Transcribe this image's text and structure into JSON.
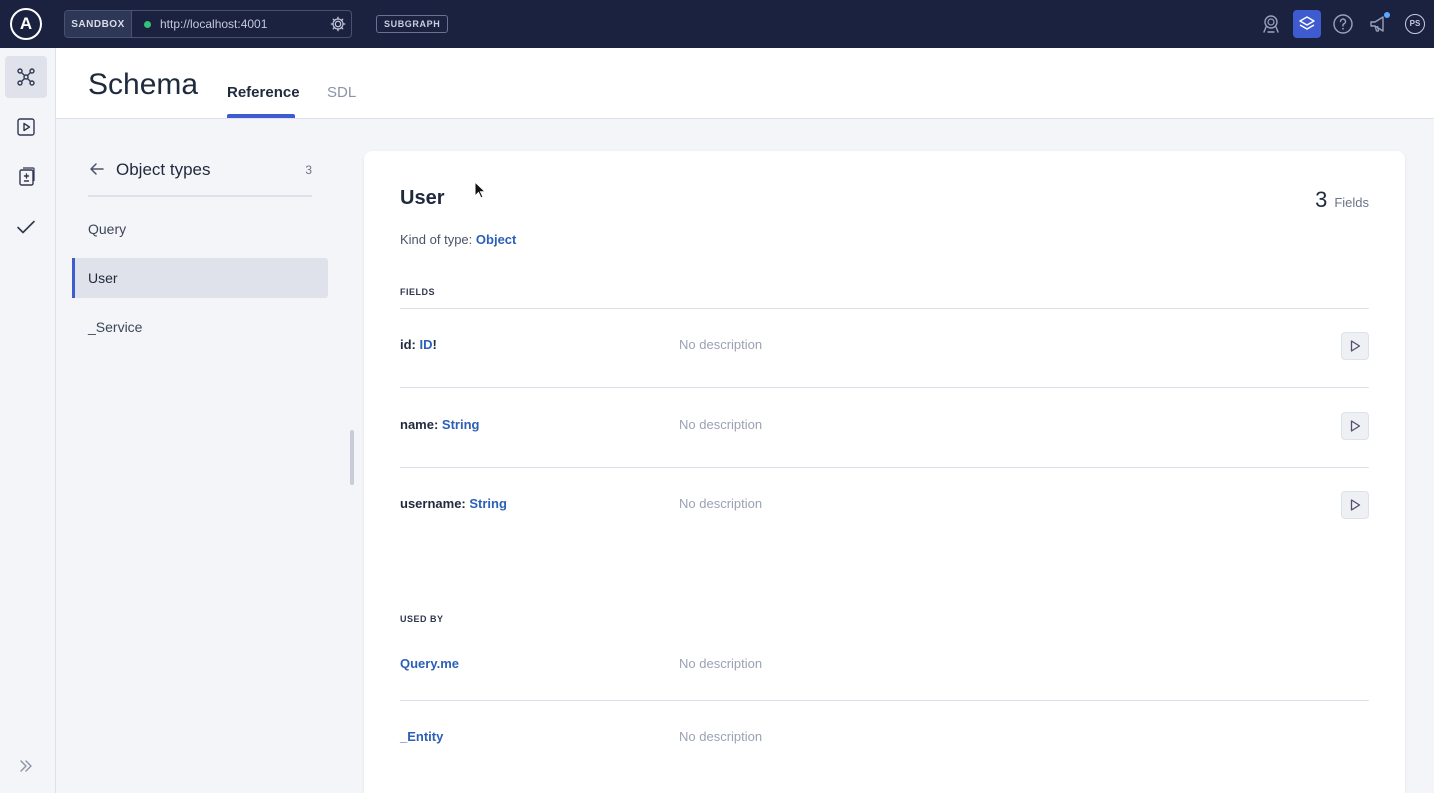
{
  "topbar": {
    "logo": "A",
    "sandbox_label": "SANDBOX",
    "url": "http://localhost:4001",
    "subgraph_label": "SUBGRAPH",
    "avatar_initials": "PS",
    "accent_color": "#3f5bd0",
    "status_color": "#36c07a"
  },
  "rail": {
    "items": [
      "schema-icon",
      "play-icon",
      "document-diff-icon",
      "check-icon"
    ],
    "expand_icon": "double-chevron-right-icon"
  },
  "header": {
    "title": "Schema",
    "tabs": [
      {
        "label": "Reference",
        "active": true
      },
      {
        "label": "SDL",
        "active": false
      }
    ]
  },
  "type_list": {
    "title": "Object types",
    "count": "3",
    "items": [
      {
        "label": "Query",
        "active": false
      },
      {
        "label": "User",
        "active": true
      },
      {
        "label": "_Service",
        "active": false
      }
    ]
  },
  "detail": {
    "type_name": "User",
    "field_count": "3",
    "field_count_label": "Fields",
    "kind_label": "Kind of type:",
    "kind_value": "Object",
    "fields_heading": "FIELDS",
    "fields": [
      {
        "name": "id:",
        "type": "ID",
        "suffix": "!",
        "description": "No description"
      },
      {
        "name": "name:",
        "type": "String",
        "suffix": "",
        "description": "No description"
      },
      {
        "name": "username:",
        "type": "String",
        "suffix": "",
        "description": "No description"
      }
    ],
    "used_by_heading": "USED BY",
    "used_by": [
      {
        "name": "Query.me",
        "description": "No description"
      },
      {
        "name": "_Entity",
        "description": "No description"
      }
    ]
  }
}
